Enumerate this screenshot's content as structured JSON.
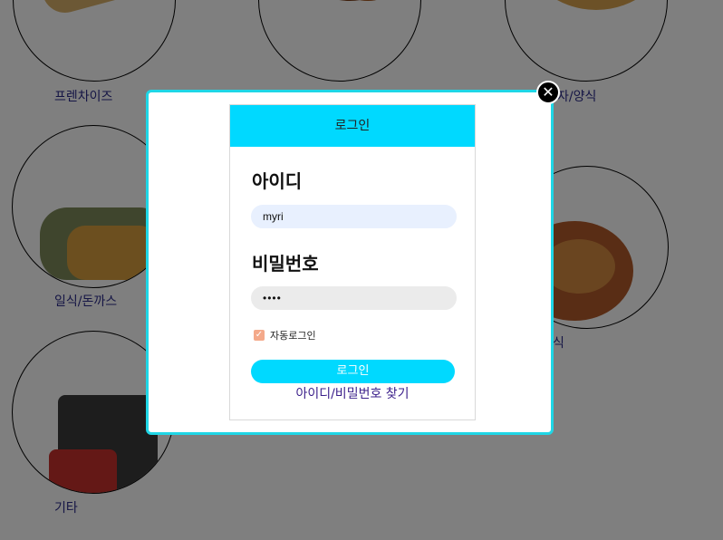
{
  "categories": [
    {
      "label": "프렌차이즈"
    },
    {
      "label": ""
    },
    {
      "label": "자/양식"
    },
    {
      "label": "일식/돈까스"
    },
    {
      "label": "식"
    },
    {
      "label": "기타"
    }
  ],
  "modal": {
    "close_icon": "✕",
    "header_title": "로그인",
    "id_label": "아이디",
    "id_value": "myri",
    "password_label": "비밀번호",
    "password_value": "••••",
    "auto_login_label": "자동로그인",
    "auto_login_checked": true,
    "login_button": "로그인",
    "find_link": "아이디/비밀번호 찾기"
  },
  "colors": {
    "accent": "#00d9ff",
    "modal_border": "#1fd6e6",
    "checkbox": "#f4a98a"
  }
}
